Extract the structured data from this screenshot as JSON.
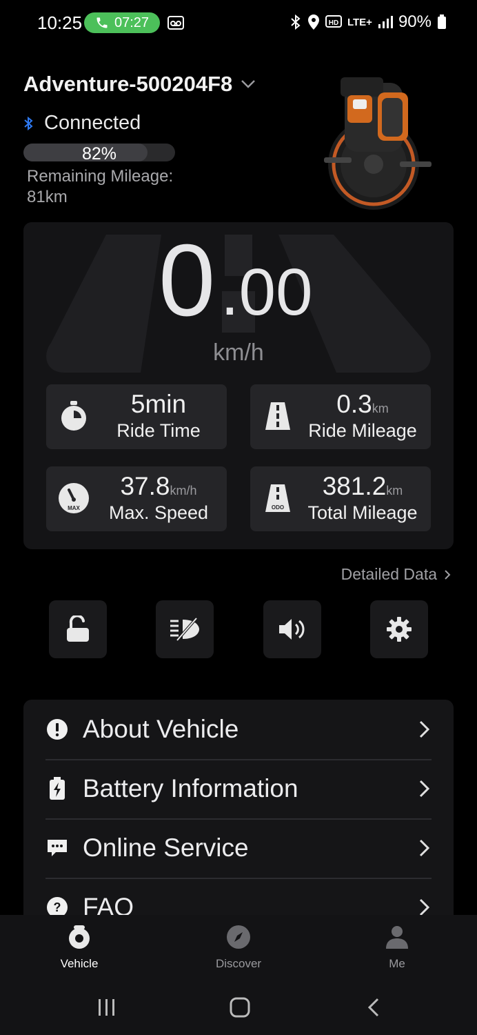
{
  "status_bar": {
    "time": "10:25",
    "call_timer": "07:27",
    "network": "LTE+",
    "battery": "90%"
  },
  "header": {
    "device_name": "Adventure-500204F8",
    "connection_status": "Connected",
    "battery_percent": "82%",
    "battery_level": 0.82,
    "remaining_label": "Remaining Mileage:",
    "remaining_value": "81km"
  },
  "speed": {
    "integer": "0",
    "decimal": ".00",
    "unit": "km/h"
  },
  "stats": {
    "ride_time": {
      "value": "5min",
      "unit": "",
      "label": "Ride Time"
    },
    "ride_mileage": {
      "value": "0.3",
      "unit": "km",
      "label": "Ride Mileage"
    },
    "max_speed": {
      "value": "37.8",
      "unit": "km/h",
      "label": "Max. Speed",
      "icon_text": "MAX"
    },
    "total_mileage": {
      "value": "381.2",
      "unit": "km",
      "label": "Total Mileage",
      "icon_text": "ODO"
    }
  },
  "detailed_data_label": "Detailed Data",
  "quick_actions": [
    "unlock-icon",
    "light-off-icon",
    "volume-icon",
    "gear-icon"
  ],
  "menu": {
    "items": [
      {
        "label": "About Vehicle",
        "icon": "info-icon"
      },
      {
        "label": "Battery Information",
        "icon": "battery-icon"
      },
      {
        "label": "Online Service",
        "icon": "chat-icon"
      },
      {
        "label": "FAQ",
        "icon": "help-icon"
      }
    ]
  },
  "bottom_nav": {
    "vehicle": "Vehicle",
    "discover": "Discover",
    "me": "Me"
  },
  "colors": {
    "accent_green": "#4cc05a",
    "bluetooth_blue": "#2f7bf5",
    "background": "#000000",
    "panel": "#141416"
  }
}
